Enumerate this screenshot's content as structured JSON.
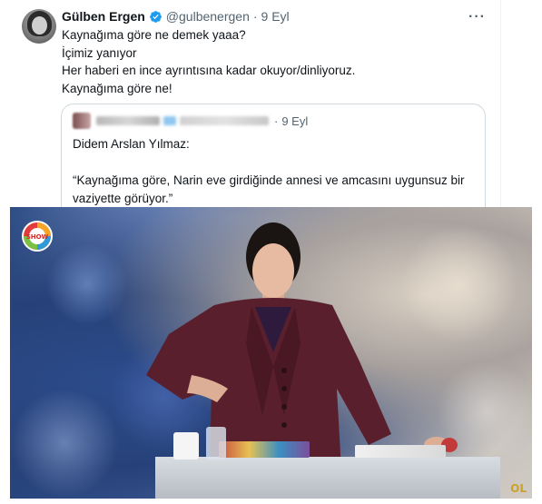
{
  "tweet": {
    "author_name": "Gülben Ergen",
    "author_handle": "@gulbenergen",
    "separator": "·",
    "date": "9 Eyl",
    "more_label": "···",
    "lines": [
      "Kaynağıma göre ne demek yaaa?",
      "İçimiz yanıyor",
      "Her haberi en ince ayrıntısına kadar okuyor/dinliyoruz.",
      "Kaynağıma göre ne!"
    ]
  },
  "quoted_tweet": {
    "date": "9 Eyl",
    "separator": "·",
    "lines": [
      "Didem Arslan Yılmaz:",
      "",
      "“Kaynağıma göre, Narin eve girdiğinde annesi ve amcasını uygunsuz bir",
      "vaziyette görüyor.”"
    ]
  },
  "media": {
    "channel_logo": "SHOW",
    "watermark": "OL",
    "colors": {
      "verified_badge": "#1d9bf0",
      "blazer": "#5a1f2c",
      "logo_ring": "#e23b3b"
    }
  }
}
